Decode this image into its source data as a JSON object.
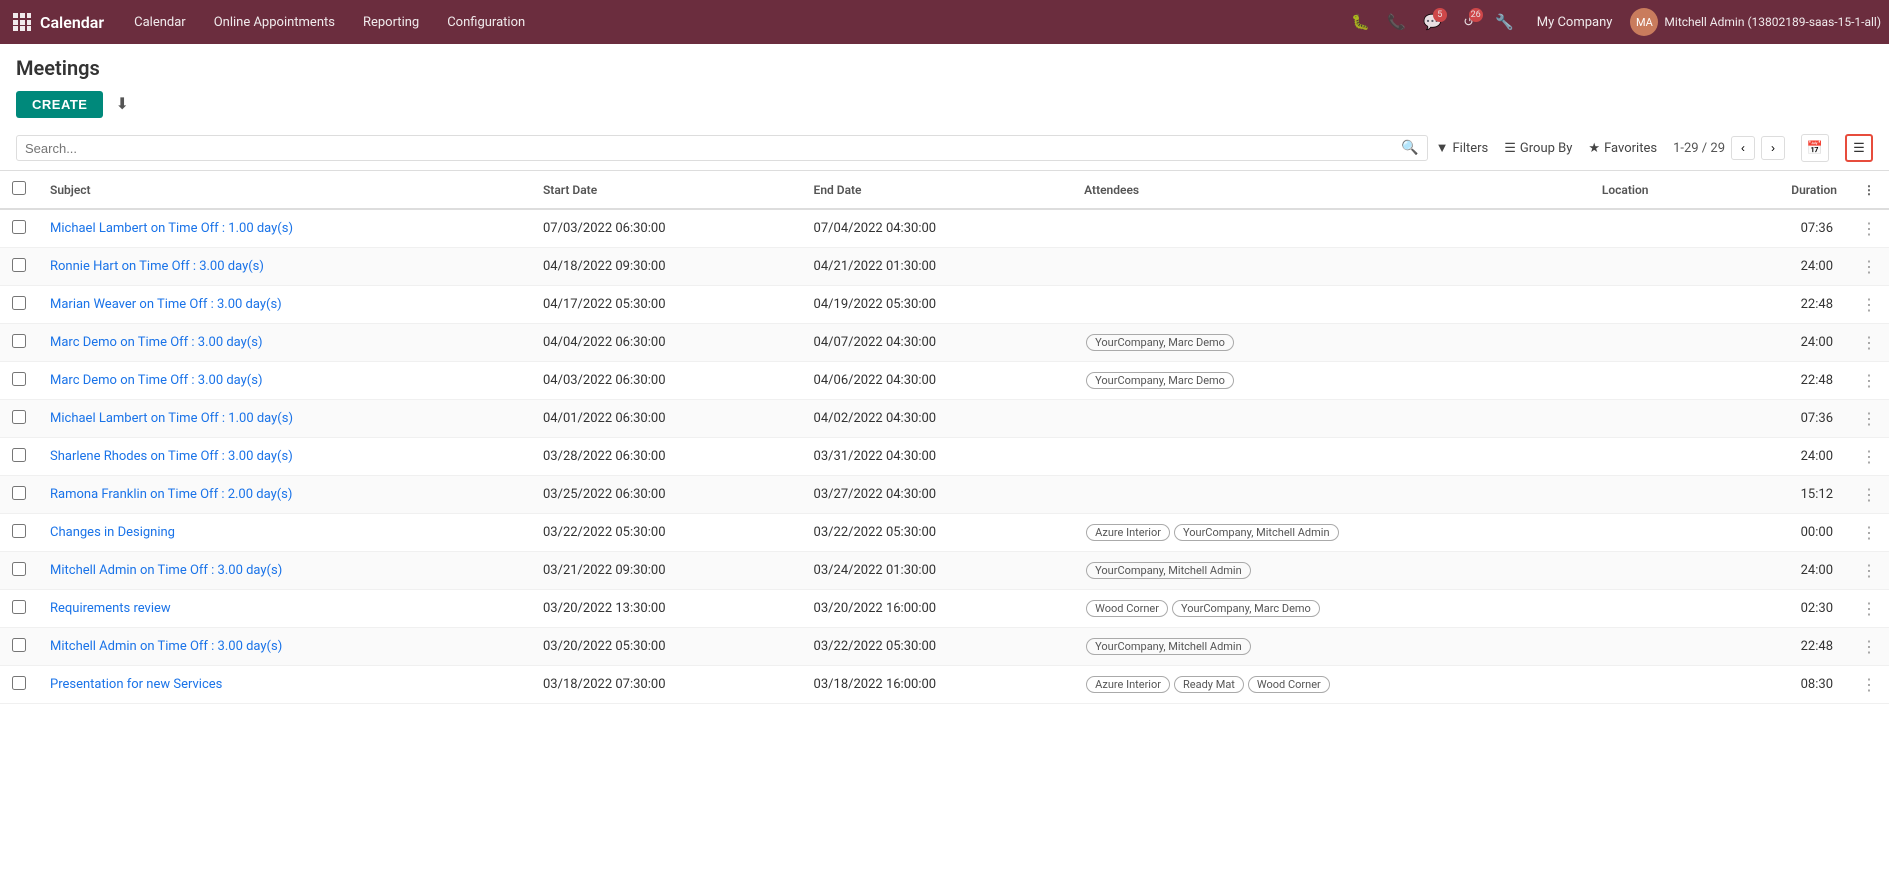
{
  "app": {
    "title": "Calendar",
    "nav_items": [
      "Calendar",
      "Online Appointments",
      "Reporting",
      "Configuration"
    ]
  },
  "header": {
    "icons": {
      "bug": "🐛",
      "phone": "📞",
      "chat_count": "5",
      "clock_count": "26"
    },
    "company": "My Company",
    "user": "Mitchell Admin (13802189-saas-15-1-all)"
  },
  "page": {
    "title": "Meetings",
    "create_label": "CREATE"
  },
  "search": {
    "placeholder": "Search..."
  },
  "controls": {
    "filters_label": "Filters",
    "group_by_label": "Group By",
    "favorites_label": "Favorites",
    "pagination": "1-29 / 29"
  },
  "table": {
    "columns": [
      "Subject",
      "Start Date",
      "End Date",
      "Attendees",
      "Location",
      "Duration"
    ],
    "rows": [
      {
        "subject": "Michael Lambert on Time Off : 1.00 day(s)",
        "start_date": "07/03/2022 06:30:00",
        "end_date": "07/04/2022 04:30:00",
        "attendees": [],
        "location": "",
        "duration": "07:36"
      },
      {
        "subject": "Ronnie Hart on Time Off : 3.00 day(s)",
        "start_date": "04/18/2022 09:30:00",
        "end_date": "04/21/2022 01:30:00",
        "attendees": [],
        "location": "",
        "duration": "24:00"
      },
      {
        "subject": "Marian Weaver on Time Off : 3.00 day(s)",
        "start_date": "04/17/2022 05:30:00",
        "end_date": "04/19/2022 05:30:00",
        "attendees": [],
        "location": "",
        "duration": "22:48"
      },
      {
        "subject": "Marc Demo on Time Off : 3.00 day(s)",
        "start_date": "04/04/2022 06:30:00",
        "end_date": "04/07/2022 04:30:00",
        "attendees": [
          "YourCompany, Marc Demo"
        ],
        "location": "",
        "duration": "24:00"
      },
      {
        "subject": "Marc Demo on Time Off : 3.00 day(s)",
        "start_date": "04/03/2022 06:30:00",
        "end_date": "04/06/2022 04:30:00",
        "attendees": [
          "YourCompany, Marc Demo"
        ],
        "location": "",
        "duration": "22:48"
      },
      {
        "subject": "Michael Lambert on Time Off : 1.00 day(s)",
        "start_date": "04/01/2022 06:30:00",
        "end_date": "04/02/2022 04:30:00",
        "attendees": [],
        "location": "",
        "duration": "07:36"
      },
      {
        "subject": "Sharlene Rhodes on Time Off : 3.00 day(s)",
        "start_date": "03/28/2022 06:30:00",
        "end_date": "03/31/2022 04:30:00",
        "attendees": [],
        "location": "",
        "duration": "24:00"
      },
      {
        "subject": "Ramona Franklin on Time Off : 2.00 day(s)",
        "start_date": "03/25/2022 06:30:00",
        "end_date": "03/27/2022 04:30:00",
        "attendees": [],
        "location": "",
        "duration": "15:12"
      },
      {
        "subject": "Changes in Designing",
        "start_date": "03/22/2022 05:30:00",
        "end_date": "03/22/2022 05:30:00",
        "attendees": [
          "Azure Interior",
          "YourCompany, Mitchell Admin"
        ],
        "location": "",
        "duration": "00:00"
      },
      {
        "subject": "Mitchell Admin on Time Off : 3.00 day(s)",
        "start_date": "03/21/2022 09:30:00",
        "end_date": "03/24/2022 01:30:00",
        "attendees": [
          "YourCompany, Mitchell Admin"
        ],
        "location": "",
        "duration": "24:00"
      },
      {
        "subject": "Requirements review",
        "start_date": "03/20/2022 13:30:00",
        "end_date": "03/20/2022 16:00:00",
        "attendees": [
          "Wood Corner",
          "YourCompany, Marc Demo"
        ],
        "location": "",
        "duration": "02:30"
      },
      {
        "subject": "Mitchell Admin on Time Off : 3.00 day(s)",
        "start_date": "03/20/2022 05:30:00",
        "end_date": "03/22/2022 05:30:00",
        "attendees": [
          "YourCompany, Mitchell Admin"
        ],
        "location": "",
        "duration": "22:48"
      },
      {
        "subject": "Presentation for new Services",
        "start_date": "03/18/2022 07:30:00",
        "end_date": "03/18/2022 16:00:00",
        "attendees": [
          "Azure Interior",
          "Ready Mat",
          "Wood Corner"
        ],
        "location": "",
        "duration": "08:30"
      }
    ]
  }
}
